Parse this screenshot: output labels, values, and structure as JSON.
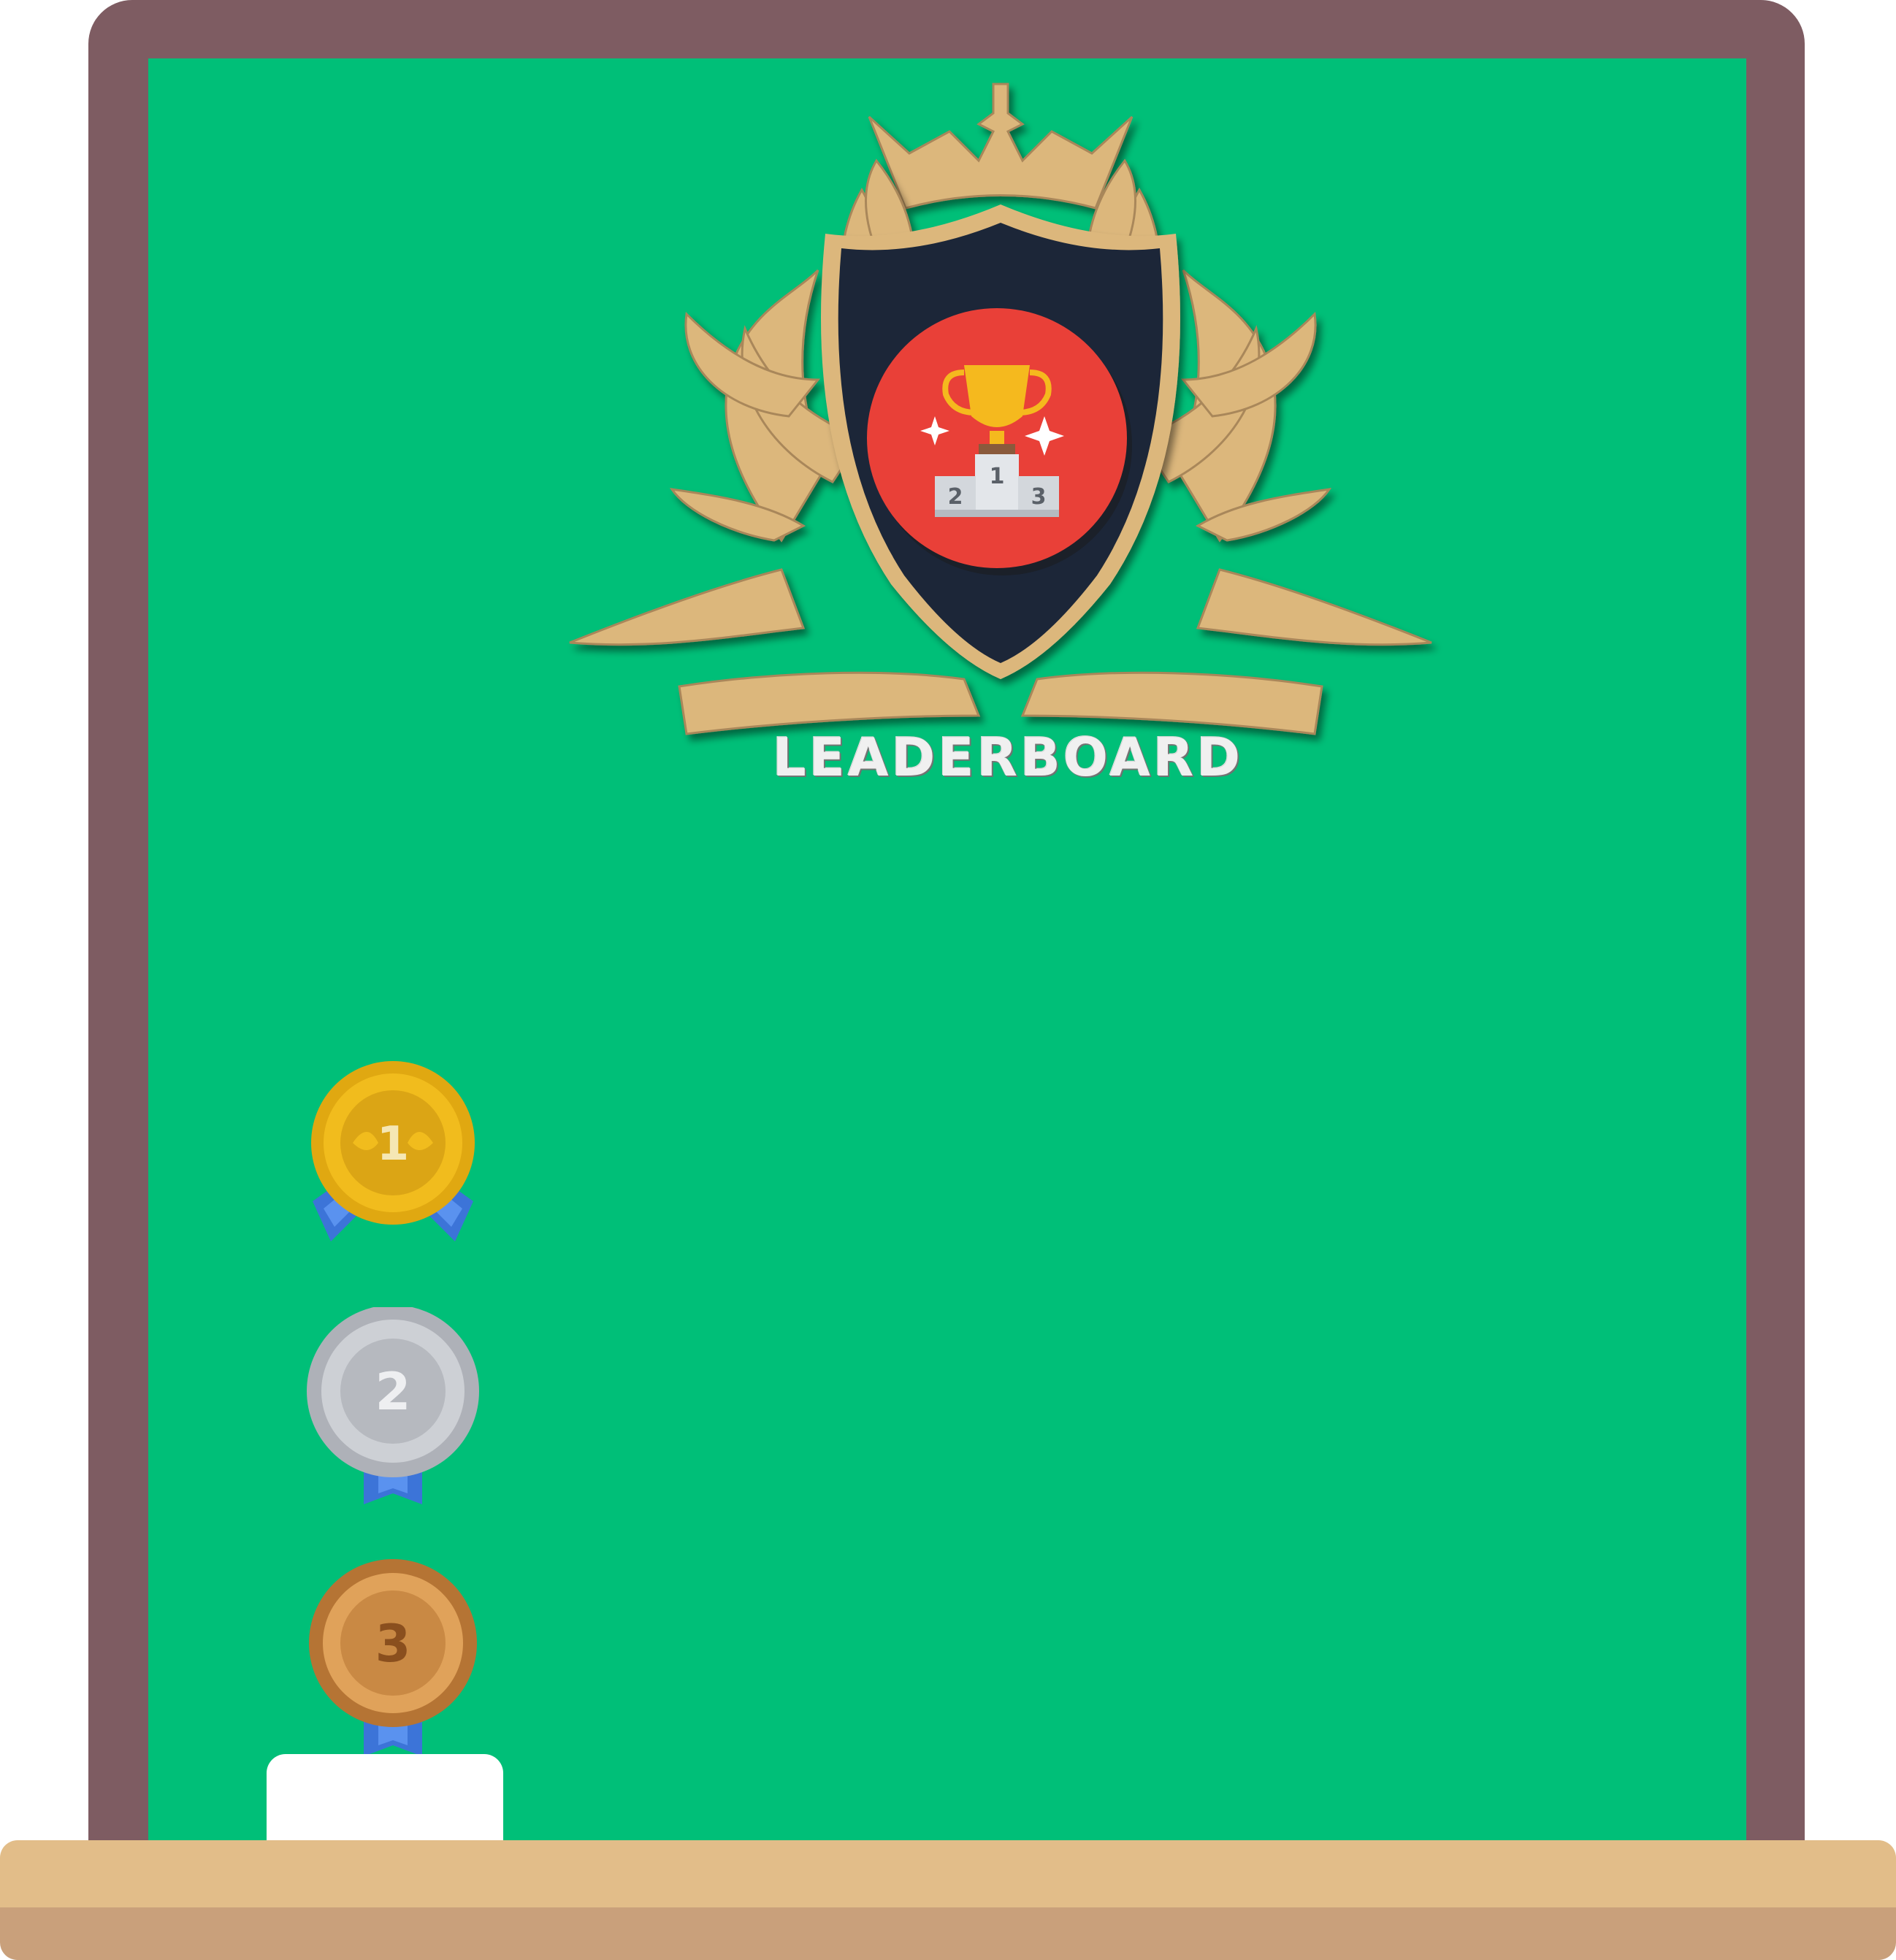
{
  "title": "LEADERBOARD",
  "colors": {
    "board": "#00bf78",
    "frame": "#7e5c62",
    "ledge": "#e2bd89",
    "crest_gold": "#dcb77c",
    "shield": "#1f2838",
    "badge_red": "#e94038"
  },
  "podium_numbers": [
    "2",
    "1",
    "3"
  ],
  "medals": [
    {
      "rank": "1",
      "type": "gold",
      "icon": "gold-medal-icon"
    },
    {
      "rank": "2",
      "type": "silver",
      "icon": "silver-medal-icon"
    },
    {
      "rank": "3",
      "type": "bronze",
      "icon": "bronze-medal-icon"
    }
  ]
}
